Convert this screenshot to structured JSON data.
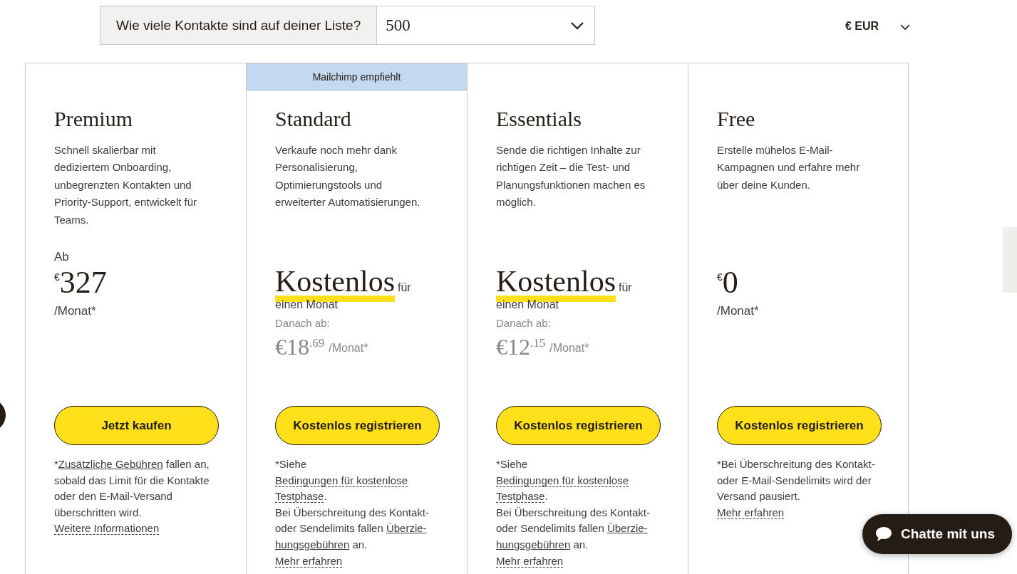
{
  "contacts_selector": {
    "label": "Wie viele Kontakte sind auf deiner Liste?",
    "value": "500"
  },
  "currency": {
    "value": "€ EUR"
  },
  "plans": [
    {
      "name": "Premium",
      "description": "Schnell skalierbar mit dediziertem Onboarding, unbegrenzten Kontakten und Priority-Support, entwickelt für Teams.",
      "price": {
        "kind": "from",
        "prefix": "Ab",
        "currency": "€",
        "amount": "327",
        "period": "/Monat*"
      },
      "button": "Jetzt kaufen",
      "note": [
        [
          {
            "kind": "text",
            "text": "*"
          },
          {
            "kind": "link",
            "text": "Zusätzliche Gebühren"
          },
          {
            "kind": "text",
            "text": " fallen an, sobald das Limit für die Kontakte oder den E-Mail-Versand überschritten wird."
          }
        ],
        [
          {
            "kind": "dotted-link",
            "text": "Weitere Informationen"
          }
        ]
      ]
    },
    {
      "name": "Standard",
      "badge": "Mailchimp empfiehlt",
      "description": "Verkaufe noch mehr dank Personalisierung, Optimierungstools und erweiterter Automatisierungen.",
      "price": {
        "kind": "trial",
        "headline": "Kostenlos",
        "suffix": "für",
        "subline": "einen Monat",
        "then": "Danach ab:",
        "currency": "€",
        "amount": "18",
        "cents": ".69",
        "period": "/Monat*"
      },
      "button": "Kostenlos registrieren",
      "note": [
        [
          {
            "kind": "text",
            "text": "*Siehe"
          }
        ],
        [
          {
            "kind": "dotted-link",
            "text": "Bedingungen für kostenlose"
          }
        ],
        [
          {
            "kind": "dotted-link",
            "text": "Testphase"
          },
          {
            "kind": "text",
            "text": "."
          }
        ],
        [
          {
            "kind": "text",
            "text": "Bei Überschreitung des Kontakt- oder Sendelimits fallen "
          },
          {
            "kind": "link",
            "text": "Überzie-"
          },
          {
            "kind": "link",
            "text": "hungsgebühren"
          },
          {
            "kind": "text",
            "text": " an."
          }
        ],
        [
          {
            "kind": "dotted-link",
            "text": "Mehr erfahren"
          }
        ]
      ]
    },
    {
      "name": "Essentials",
      "description": "Sende die richtigen Inhalte zur richtigen Zeit – die Test- und Planungsfunktionen machen es möglich.",
      "price": {
        "kind": "trial",
        "headline": "Kostenlos",
        "suffix": "für",
        "subline": "einen Monat",
        "then": "Danach ab:",
        "currency": "€",
        "amount": "12",
        "cents": ".15",
        "period": "/Monat*"
      },
      "button": "Kostenlos registrieren",
      "note": [
        [
          {
            "kind": "text",
            "text": "*Siehe"
          }
        ],
        [
          {
            "kind": "dotted-link",
            "text": "Bedingungen für kostenlose"
          }
        ],
        [
          {
            "kind": "dotted-link",
            "text": "Testphase"
          },
          {
            "kind": "text",
            "text": "."
          }
        ],
        [
          {
            "kind": "text",
            "text": "Bei Überschreitung des Kontakt- oder Sendelimits fallen "
          },
          {
            "kind": "link",
            "text": "Überzie-"
          },
          {
            "kind": "link",
            "text": "hungsgebühren"
          },
          {
            "kind": "text",
            "text": " an."
          }
        ],
        [
          {
            "kind": "dotted-link",
            "text": "Mehr erfahren"
          }
        ]
      ]
    },
    {
      "name": "Free",
      "description": "Erstelle mühelos E-Mail-Kampagnen und erfahre mehr über deine Kunden.",
      "price": {
        "kind": "plain",
        "currency": "€",
        "amount": "0",
        "period": "/Monat*"
      },
      "button": "Kostenlos registrieren",
      "note": [
        [
          {
            "kind": "text",
            "text": "*Bei Überschreitung des Kontakt- oder E-Mail-Sendelimits wird der Versand pausiert."
          }
        ],
        [
          {
            "kind": "dotted-link",
            "text": "Mehr erfahren"
          }
        ]
      ]
    }
  ],
  "chat_button": {
    "label": "Chatte mit uns"
  }
}
